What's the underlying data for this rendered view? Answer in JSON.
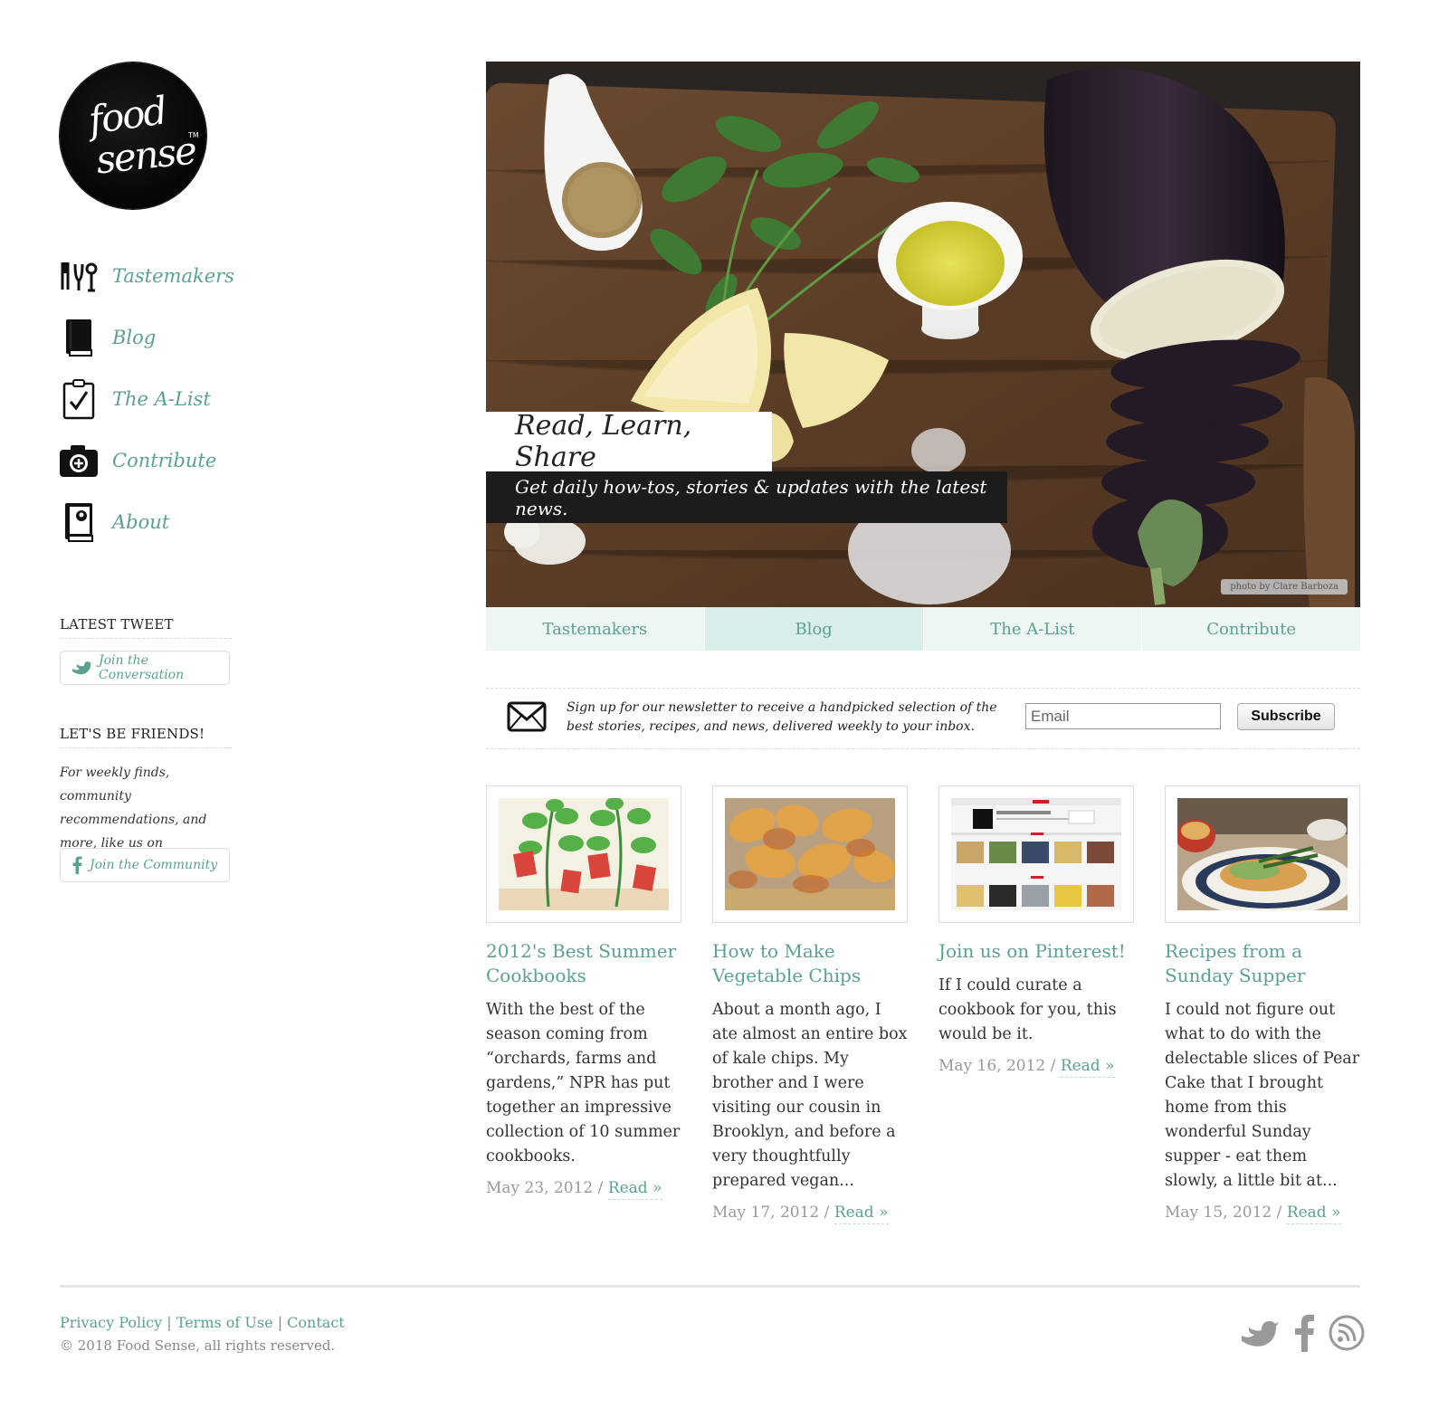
{
  "brand": {
    "logo_line1": "food",
    "logo_line2": "sense",
    "logo_tm": "TM"
  },
  "sidebar": {
    "nav": [
      {
        "label": "Tastemakers",
        "icon": "utensils-icon"
      },
      {
        "label": "Blog",
        "icon": "book-icon"
      },
      {
        "label": "The A-List",
        "icon": "clipboard-check-icon"
      },
      {
        "label": "Contribute",
        "icon": "camera-plus-icon"
      },
      {
        "label": "About",
        "icon": "profile-book-icon"
      }
    ],
    "tweet_heading": "LATEST TWEET",
    "tweet_button": "Join the Conversation",
    "friends_heading": "LET'S BE FRIENDS!",
    "friends_text": "For weekly finds, community recommendations, and more, like us on Facebook.",
    "friends_button": "Join the Community"
  },
  "hero": {
    "title": "Read, Learn, Share",
    "subtitle": "Get daily how-tos, stories & updates with the latest news.",
    "credit": "photo by Clare Barboza"
  },
  "tabs": [
    {
      "label": "Tastemakers",
      "active": false
    },
    {
      "label": "Blog",
      "active": true
    },
    {
      "label": "The A-List",
      "active": false
    },
    {
      "label": "Contribute",
      "active": false
    }
  ],
  "newsletter": {
    "text": "Sign up for our newsletter to receive a handpicked selection of the best stories, recipes, and news, delivered weekly to your inbox.",
    "placeholder": "Email",
    "button": "Subscribe"
  },
  "posts": [
    {
      "title": "2012's Best Summer Cookbooks",
      "excerpt": "With the best of the season coming from “orchards, farms and gardens,” NPR has put together an impressive collection of 10 summer cookbooks.",
      "date": "May 23, 2012",
      "read": "Read »"
    },
    {
      "title": "How to Make Vegetable Chips",
      "excerpt": "About a month ago, I ate almost an entire box of kale chips. My brother and I were visiting our cousin in Brooklyn, and before a very thoughtfully prepared vegan...",
      "date": "May 17, 2012",
      "read": "Read »"
    },
    {
      "title": "Join us on Pinterest!",
      "excerpt": "If I could curate a cookbook for you, this would be it.",
      "date": "May 16, 2012",
      "read": "Read »"
    },
    {
      "title": "Recipes from a Sunday Supper",
      "excerpt": "I could not figure out what to do with the delectable slices of Pear Cake that I brought home from this wonderful Sunday supper - eat them slowly, a little bit at...",
      "date": "May 15, 2012",
      "read": "Read »"
    }
  ],
  "footer": {
    "links": [
      "Privacy Policy",
      "Terms of Use",
      "Contact"
    ],
    "separator": "|",
    "copyright": "© 2018 Food Sense, all rights reserved.",
    "social": [
      "twitter-icon",
      "facebook-icon",
      "rss-icon"
    ]
  },
  "colors": {
    "accent": "#5aa28f",
    "tab_bg": "#eef6f4",
    "tab_active": "#d9eeea"
  }
}
